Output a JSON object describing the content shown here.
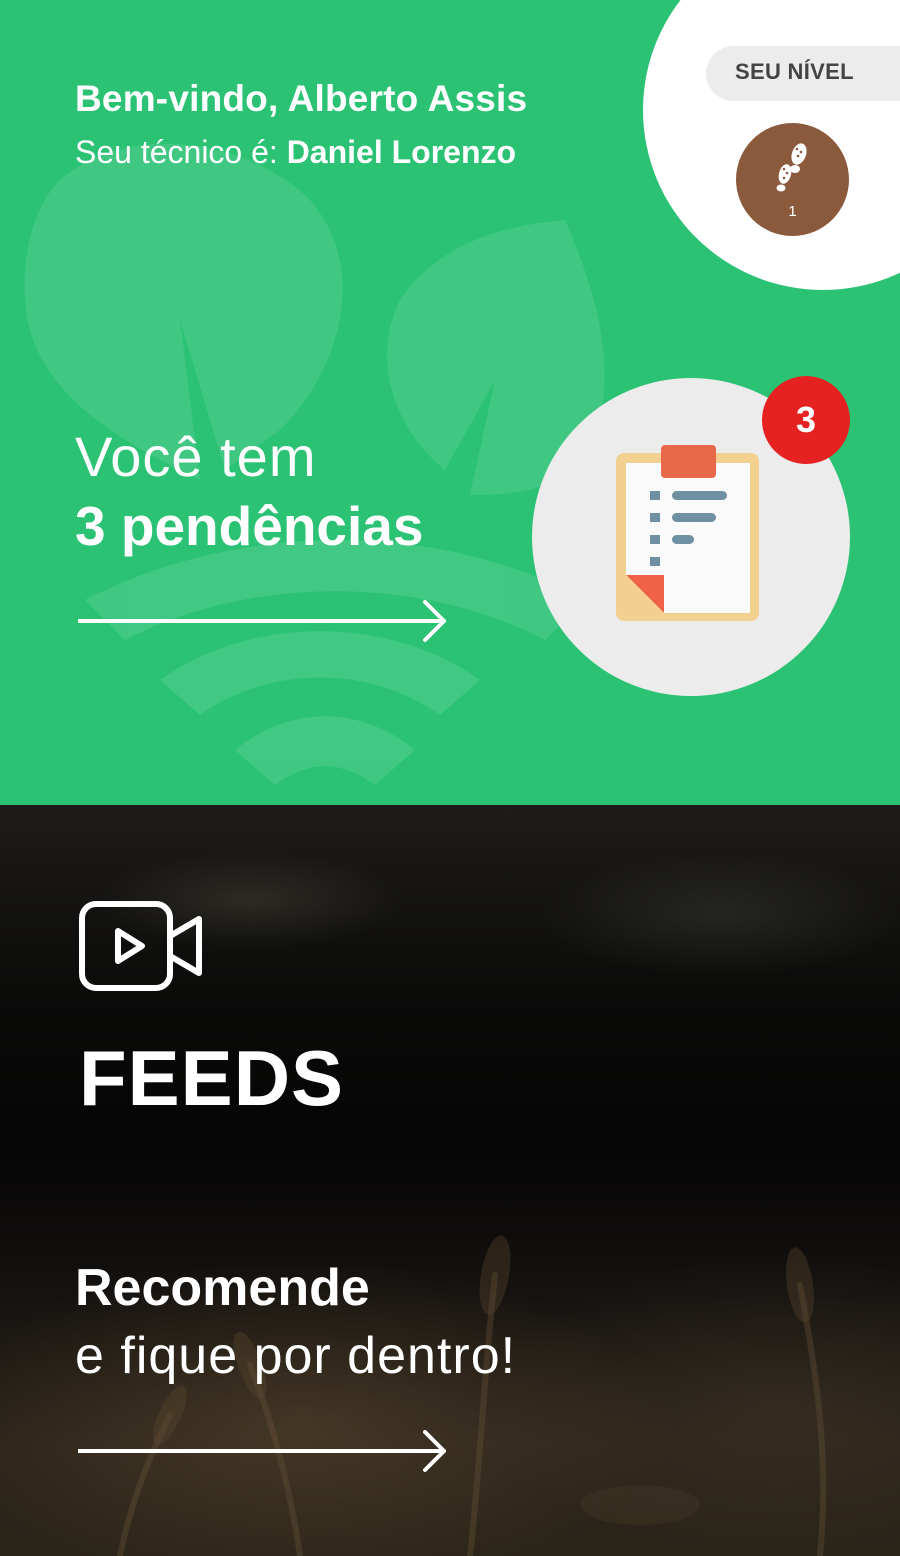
{
  "header": {
    "welcome": "Bem-vindo, Alberto Assis",
    "technician_prefix": "Seu técnico é: ",
    "technician_name": "Daniel Lorenzo"
  },
  "level": {
    "label": "SEU NÍVEL",
    "value": "1",
    "icon": "footprints-icon",
    "badge_color": "#8b5a3c"
  },
  "pending": {
    "intro": "Você tem",
    "count_text": "3 pendências",
    "badge_count": "3",
    "icon": "clipboard-icon",
    "badge_color": "#e52121"
  },
  "feeds": {
    "icon": "video-camera-icon",
    "title": "FEEDS",
    "recommend_title": "Recomende",
    "recommend_subtitle": "e fique por dentro!"
  },
  "colors": {
    "brand_green": "#2bc274",
    "white": "#ffffff"
  }
}
